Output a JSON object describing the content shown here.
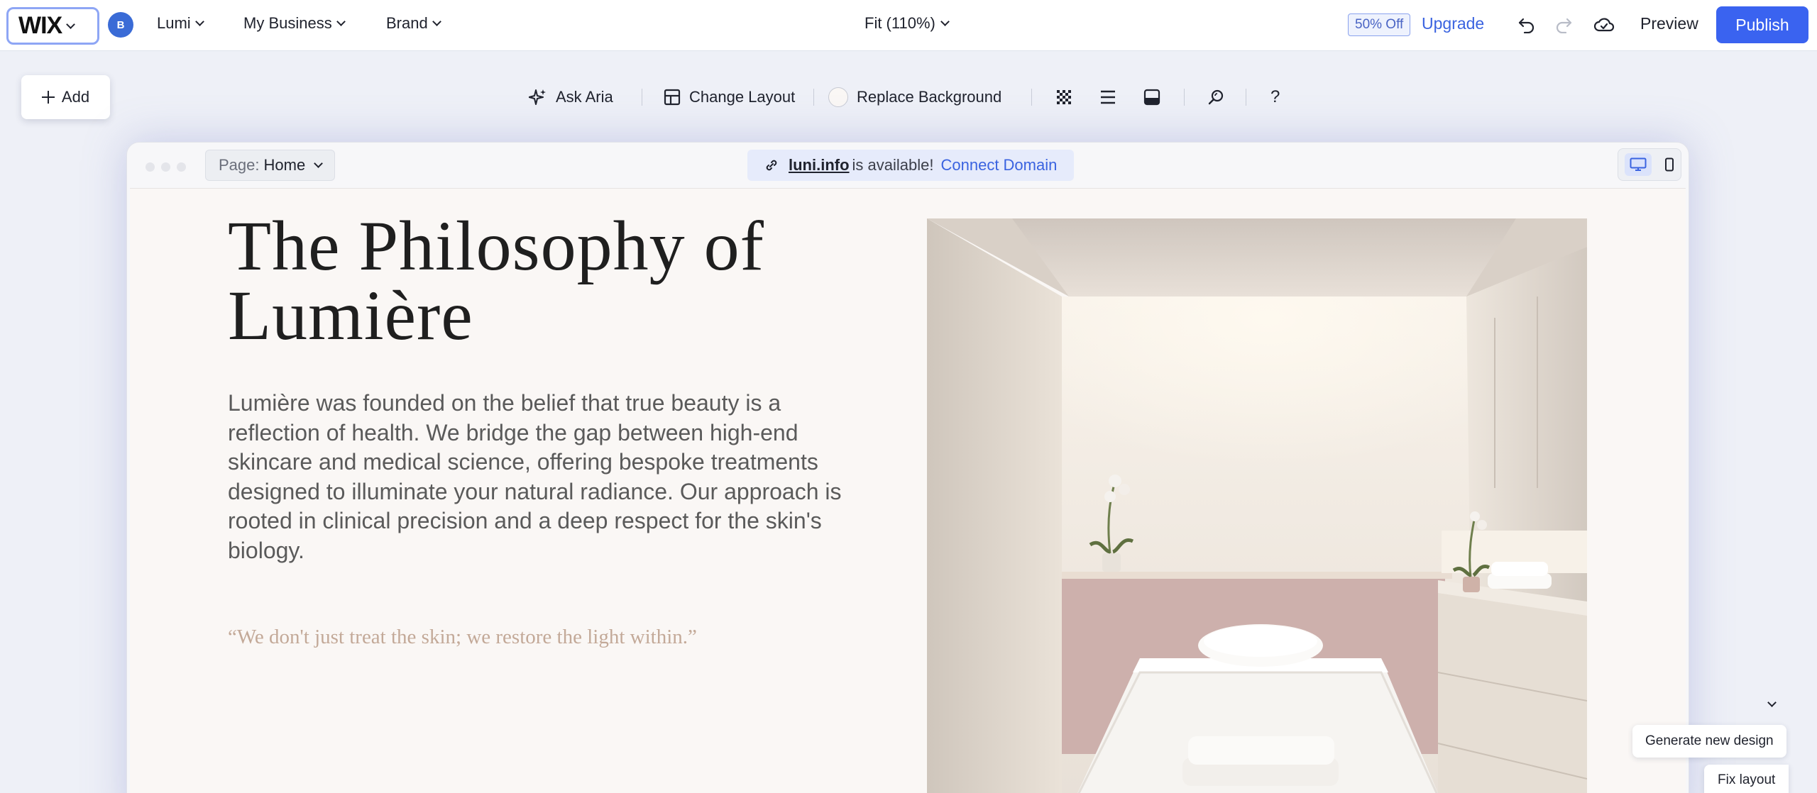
{
  "topbar": {
    "logo": "WIX",
    "avatar_letter": "B",
    "site_menu": "Lumi",
    "business_menu": "My Business",
    "brand_menu": "Brand",
    "zoom": "Fit (110%)",
    "discount_badge": "50% Off",
    "upgrade": "Upgrade",
    "preview": "Preview",
    "publish": "Publish"
  },
  "toolbar": {
    "add": "Add",
    "ask_aria": "Ask Aria",
    "change_layout": "Change Layout",
    "replace_background": "Replace Background"
  },
  "frame": {
    "page_label": "Page:",
    "page_value": "Home",
    "domain": "luni.info",
    "domain_available": "is available!",
    "connect_domain": "Connect Domain"
  },
  "content": {
    "heading": "The Philosophy of Lumière",
    "body": "Lumière was founded on the belief that true beauty is a reflection of health. We bridge the gap between high-end skincare and medical science, offering bespoke treatments designed to illuminate your natural radiance. Our approach is rooted in clinical precision and a deep respect for the skin's biology.",
    "quote": "“We don't just treat the skin; we restore the light within.”"
  },
  "actions": {
    "generate_new_design": "Generate new design",
    "fix_layout": "Fix layout"
  },
  "colors": {
    "accent": "#3a63f0",
    "canvas_bg": "#faf7f5",
    "quote": "#c3a998"
  }
}
